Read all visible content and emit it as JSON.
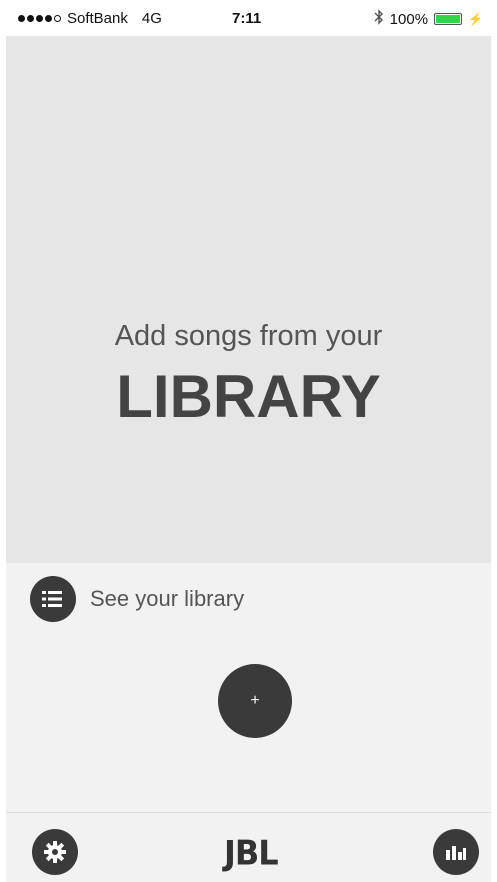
{
  "status_bar": {
    "carrier": "SoftBank",
    "network": "4G",
    "time": "7:11",
    "battery": "100%",
    "signal_bars_filled": 4,
    "signal_bars_total": 5,
    "battery_level": 1.0,
    "bluetooth_icon": "bluetooth-icon",
    "battery_color": "#2fd84a"
  },
  "hero": {
    "subtitle": "Add songs from your",
    "title": "LIBRARY"
  },
  "library": {
    "label": "See your library",
    "icon": "list-icon"
  },
  "add_button": {
    "label": "+"
  },
  "bottom_bar": {
    "logo": "JBL",
    "settings_icon": "gear-icon",
    "eq_icon": "equalizer-icon"
  },
  "colors": {
    "hero_bg": "#e6e6e6",
    "page_bg": "#f2f2f2",
    "button_bg": "#3a3a3a"
  }
}
